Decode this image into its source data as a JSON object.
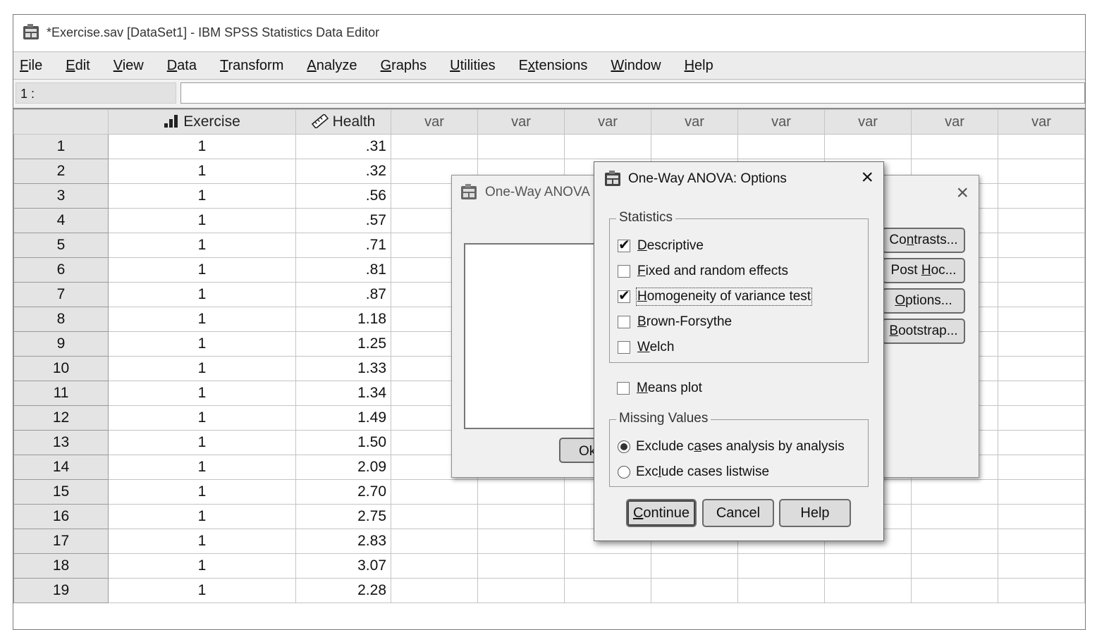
{
  "window": {
    "title": "*Exercise.sav [DataSet1] - IBM SPSS Statistics Data Editor"
  },
  "menu": [
    {
      "acc": "F",
      "rest": "ile"
    },
    {
      "acc": "E",
      "rest": "dit"
    },
    {
      "acc": "V",
      "rest": "iew"
    },
    {
      "acc": "D",
      "rest": "ata"
    },
    {
      "acc": "T",
      "rest": "ransform"
    },
    {
      "acc": "A",
      "rest": "nalyze"
    },
    {
      "acc": "G",
      "rest": "raphs"
    },
    {
      "acc": "U",
      "rest": "tilities"
    },
    {
      "pre": "E",
      "acc": "x",
      "rest": "tensions"
    },
    {
      "acc": "W",
      "rest": "indow"
    },
    {
      "acc": "H",
      "rest": "elp"
    }
  ],
  "cell_bar": {
    "ref": "1 :",
    "value": ""
  },
  "columns": [
    "Exercise",
    "Health",
    "var",
    "var",
    "var",
    "var",
    "var",
    "var",
    "var",
    "var"
  ],
  "column_icons": [
    "ordinal-bar-icon",
    "ruler-scale-icon"
  ],
  "rows": [
    {
      "n": "1",
      "exercise": "1",
      "health": ".31"
    },
    {
      "n": "2",
      "exercise": "1",
      "health": ".32"
    },
    {
      "n": "3",
      "exercise": "1",
      "health": ".56"
    },
    {
      "n": "4",
      "exercise": "1",
      "health": ".57"
    },
    {
      "n": "5",
      "exercise": "1",
      "health": ".71"
    },
    {
      "n": "6",
      "exercise": "1",
      "health": ".81"
    },
    {
      "n": "7",
      "exercise": "1",
      "health": ".87"
    },
    {
      "n": "8",
      "exercise": "1",
      "health": "1.18"
    },
    {
      "n": "9",
      "exercise": "1",
      "health": "1.25"
    },
    {
      "n": "10",
      "exercise": "1",
      "health": "1.33"
    },
    {
      "n": "11",
      "exercise": "1",
      "health": "1.34"
    },
    {
      "n": "12",
      "exercise": "1",
      "health": "1.49"
    },
    {
      "n": "13",
      "exercise": "1",
      "health": "1.50"
    },
    {
      "n": "14",
      "exercise": "1",
      "health": "2.09"
    },
    {
      "n": "15",
      "exercise": "1",
      "health": "2.70"
    },
    {
      "n": "16",
      "exercise": "1",
      "health": "2.75"
    },
    {
      "n": "17",
      "exercise": "1",
      "health": "2.83"
    },
    {
      "n": "18",
      "exercise": "1",
      "health": "3.07"
    },
    {
      "n": "19",
      "exercise": "1",
      "health": "2.28"
    }
  ],
  "back_dialog": {
    "title": "One-Way ANOVA",
    "close": "×",
    "ok": "Ok",
    "buttons": [
      {
        "pre": "Co",
        "acc": "n",
        "rest": "trasts..."
      },
      {
        "pre": "Post ",
        "acc": "H",
        "rest": "oc..."
      },
      {
        "pre": "",
        "acc": "O",
        "rest": "ptions..."
      },
      {
        "pre": "",
        "acc": "B",
        "rest": "ootstrap..."
      }
    ]
  },
  "options_dialog": {
    "title": "One-Way ANOVA: Options",
    "close": "×",
    "statistics_label": "Statistics",
    "statistics": [
      {
        "acc": "D",
        "rest": "escriptive",
        "checked": true
      },
      {
        "acc": "F",
        "rest": "ixed and random effects",
        "checked": false
      },
      {
        "acc": "H",
        "rest": "omogeneity of variance test",
        "checked": true
      },
      {
        "acc": "B",
        "rest": "rown-Forsythe",
        "checked": false
      },
      {
        "acc": "W",
        "rest": "elch",
        "checked": false
      }
    ],
    "means_plot": {
      "acc": "M",
      "rest": "eans plot",
      "checked": false
    },
    "missing_label": "Missing Values",
    "missing": [
      {
        "pre": "Exclude c",
        "acc": "a",
        "rest": "ses analysis by analysis",
        "selected": true
      },
      {
        "pre": "Exc",
        "acc": "l",
        "rest": "ude cases listwise",
        "selected": false
      }
    ],
    "buttons": {
      "continue": {
        "pre": "",
        "acc": "C",
        "rest": "ontinue"
      },
      "cancel": "Cancel",
      "help": "Help"
    }
  }
}
